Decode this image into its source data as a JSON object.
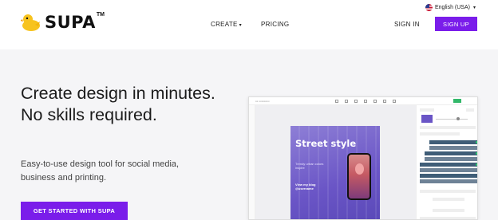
{
  "brand": {
    "name": "SUPA",
    "tm": "TM"
  },
  "nav": {
    "create": "CREATE",
    "pricing": "PRICING"
  },
  "lang": {
    "label": "English (USA)"
  },
  "auth": {
    "signin": "SIGN IN",
    "signup": "SIGN UP"
  },
  "hero": {
    "headline": "Create design in minutes. No skills required.",
    "sub": "Easy-to-use design tool for social media, business and printing.",
    "cta": "GET STARTED WITH SUPA"
  },
  "design": {
    "title": "Street style",
    "tagline": "Trendy urban colors inspire",
    "view": "View my blog",
    "handle": "@username"
  },
  "colors": {
    "accent": "#7a1dea",
    "design_bg": "#6a55c6"
  }
}
